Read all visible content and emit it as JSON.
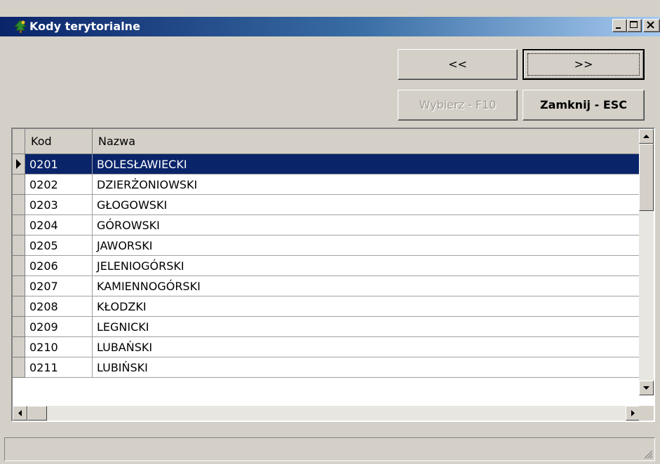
{
  "window": {
    "title": "Kody terytorialne"
  },
  "nav": {
    "prev_label": "<<",
    "next_label": ">>"
  },
  "actions": {
    "select_label": "Wybierz - F10",
    "close_label": "Zamknij - ESC"
  },
  "table": {
    "columns": [
      "Kod",
      "Nazwa"
    ],
    "selected_row": 0,
    "rows": [
      {
        "kod": "0201",
        "nazwa": "BOLESŁAWIECKI"
      },
      {
        "kod": "0202",
        "nazwa": "DZIERŻONIOWSKI"
      },
      {
        "kod": "0203",
        "nazwa": "GŁOGOWSKI"
      },
      {
        "kod": "0204",
        "nazwa": "GÓROWSKI"
      },
      {
        "kod": "0205",
        "nazwa": "JAWORSKI"
      },
      {
        "kod": "0206",
        "nazwa": "JELENIOGÓRSKI"
      },
      {
        "kod": "0207",
        "nazwa": "KAMIENNOGÓRSKI"
      },
      {
        "kod": "0208",
        "nazwa": "KŁODZKI"
      },
      {
        "kod": "0209",
        "nazwa": "LEGNICKI"
      },
      {
        "kod": "0210",
        "nazwa": "LUBAŃSKI"
      },
      {
        "kod": "0211",
        "nazwa": "LUBIŃSKI"
      }
    ]
  },
  "colors": {
    "titlebar": "#0a246a",
    "selection": "#0a246a",
    "face": "#d4d0c8"
  },
  "icons": {
    "app": "tree-icon",
    "minimize": "minimize-icon",
    "maximize": "maximize-icon",
    "close": "close-icon"
  }
}
